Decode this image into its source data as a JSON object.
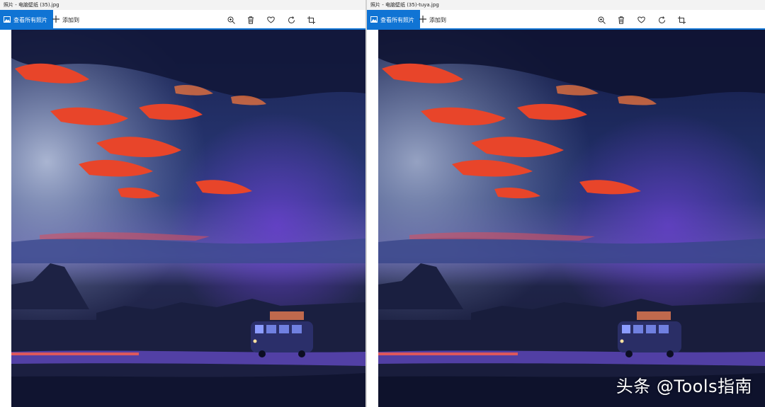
{
  "left_window": {
    "title": "照片 - 电脑壁纸 (35).jpg",
    "view_all_label": "查看所有照片",
    "add_to_label": "添加到"
  },
  "right_window": {
    "title": "照片 - 电脑壁纸 (35)-tuya.jpg",
    "view_all_label": "查看所有照片",
    "add_to_label": "添加到"
  },
  "toolbar_icons": [
    "zoom-icon",
    "delete-icon",
    "favorite-icon",
    "rotate-icon",
    "crop-icon"
  ],
  "colors": {
    "accent": "#1074d4",
    "sky_dark": "#141a3a",
    "cloud_red": "#e8452a",
    "haze_blue": "#7f8fb8",
    "ground": "#1b1f40"
  },
  "watermark": "头条 @Tools指南"
}
